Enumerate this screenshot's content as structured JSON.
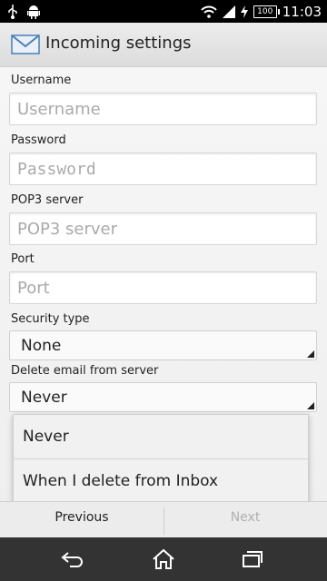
{
  "status_bar": {
    "time": "11:03",
    "battery": "100",
    "icons": [
      "usb-icon",
      "android-icon",
      "wifi-icon",
      "signal-icon",
      "charging-icon",
      "battery-icon"
    ]
  },
  "header": {
    "title": "Incoming settings",
    "icon": "mail-icon"
  },
  "form": {
    "username": {
      "label": "Username",
      "placeholder": "Username",
      "value": ""
    },
    "password": {
      "label": "Password",
      "placeholder": "Password",
      "value": ""
    },
    "pop3_server": {
      "label": "POP3 server",
      "placeholder": "POP3 server",
      "value": ""
    },
    "port": {
      "label": "Port",
      "placeholder": "Port",
      "value": ""
    },
    "security_type": {
      "label": "Security type",
      "value": "None"
    },
    "delete_email": {
      "label": "Delete email from server",
      "value": "Never"
    }
  },
  "dropdown": {
    "options": [
      "Never",
      "When I delete from Inbox"
    ]
  },
  "footer": {
    "previous_label": "Previous",
    "next_label": "Next"
  },
  "nav": {
    "icons": [
      "back-icon",
      "home-icon",
      "recent-apps-icon"
    ]
  },
  "colors": {
    "status_bar": "#000000",
    "nav_bar": "#333333",
    "enabled_text": "#222222",
    "disabled_text": "#b0b0b0",
    "placeholder_text": "#aaaaaa"
  }
}
